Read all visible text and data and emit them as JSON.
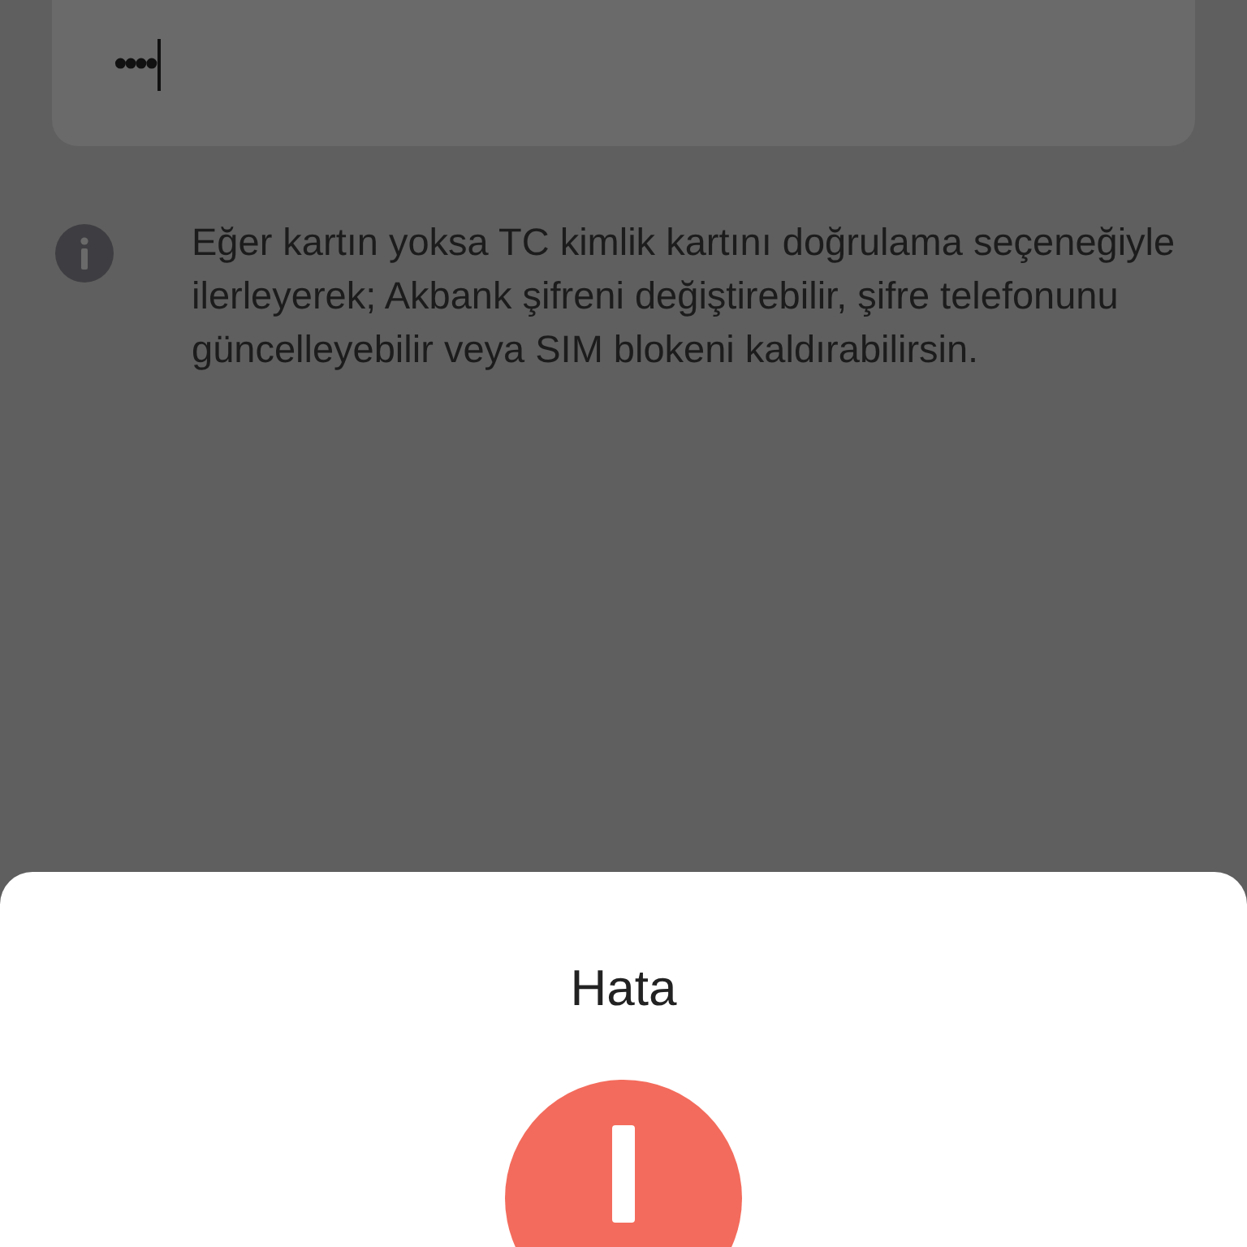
{
  "password_field": {
    "value": "••••"
  },
  "info": {
    "text": "Eğer kartın yoksa TC kimlik kartını doğrulama seçeneğiyle ilerleyerek; Akbank şifreni değiştirebilir, şifre telefonunu güncelleyebilir veya SIM blokeni kaldırabilirsin."
  },
  "sheet": {
    "title": "Hata"
  }
}
